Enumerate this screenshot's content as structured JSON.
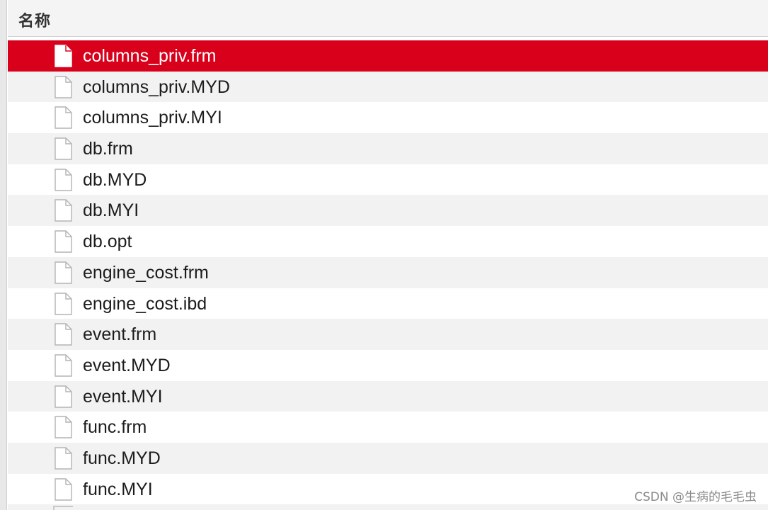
{
  "header": {
    "column_label": "名称"
  },
  "files": [
    {
      "name": "columns_priv.frm",
      "selected": true
    },
    {
      "name": "columns_priv.MYD",
      "selected": false
    },
    {
      "name": "columns_priv.MYI",
      "selected": false
    },
    {
      "name": "db.frm",
      "selected": false
    },
    {
      "name": "db.MYD",
      "selected": false
    },
    {
      "name": "db.MYI",
      "selected": false
    },
    {
      "name": "db.opt",
      "selected": false
    },
    {
      "name": "engine_cost.frm",
      "selected": false
    },
    {
      "name": "engine_cost.ibd",
      "selected": false
    },
    {
      "name": "event.frm",
      "selected": false
    },
    {
      "name": "event.MYD",
      "selected": false
    },
    {
      "name": "event.MYI",
      "selected": false
    },
    {
      "name": "func.frm",
      "selected": false
    },
    {
      "name": "func.MYD",
      "selected": false
    },
    {
      "name": "func.MYI",
      "selected": false
    }
  ],
  "icons": {
    "file": "document-icon"
  },
  "colors": {
    "selection": "#d8001b",
    "stripe": "#f2f2f2"
  },
  "watermark": "CSDN @生病的毛毛虫"
}
